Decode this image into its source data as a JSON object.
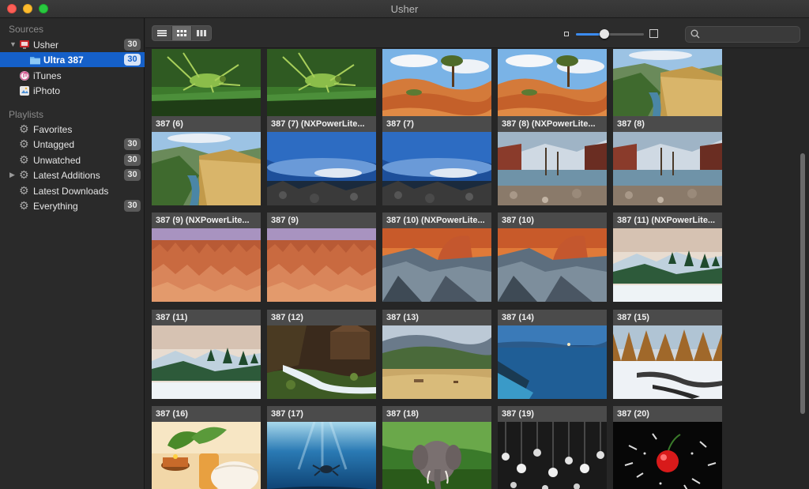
{
  "window": {
    "title": "Usher"
  },
  "sidebar": {
    "sources_header": "Sources",
    "sources": [
      {
        "label": "Usher",
        "count": "30",
        "icon": "usher-app-icon"
      },
      {
        "label": "Ultra 387",
        "count": "30",
        "icon": "folder-icon",
        "selected": true
      },
      {
        "label": "iTunes",
        "count": "",
        "icon": "itunes-icon"
      },
      {
        "label": "iPhoto",
        "count": "",
        "icon": "iphoto-icon"
      }
    ],
    "playlists_header": "Playlists",
    "playlists": [
      {
        "label": "Favorites",
        "count": ""
      },
      {
        "label": "Untagged",
        "count": "30"
      },
      {
        "label": "Unwatched",
        "count": "30"
      },
      {
        "label": "Latest Additions",
        "count": "30"
      },
      {
        "label": "Latest Downloads",
        "count": ""
      },
      {
        "label": "Everything",
        "count": "30"
      }
    ]
  },
  "toolbar": {
    "view_modes": [
      "list-view-icon",
      "grid-view-icon",
      "column-view-icon"
    ],
    "active_view": 1,
    "zoom_level": 0.42,
    "search_placeholder": ""
  },
  "grid": {
    "items": [
      {
        "title": "",
        "thumb": "grasshopper"
      },
      {
        "title": "",
        "thumb": "grasshopper"
      },
      {
        "title": "",
        "thumb": "desert-tree"
      },
      {
        "title": "",
        "thumb": "desert-tree"
      },
      {
        "title": "",
        "thumb": "canyon-river"
      },
      {
        "title": "387 (6)",
        "thumb": "canyon-river"
      },
      {
        "title": "387 (7) (NXPowerLite...",
        "thumb": "blue-sky-rocks"
      },
      {
        "title": "387 (7)",
        "thumb": "blue-sky-rocks"
      },
      {
        "title": "387 (8) (NXPowerLite...",
        "thumb": "lake-trees"
      },
      {
        "title": "387 (8)",
        "thumb": "lake-trees"
      },
      {
        "title": "387 (9) (NXPowerLite...",
        "thumb": "bryce-canyon"
      },
      {
        "title": "387 (9)",
        "thumb": "bryce-canyon"
      },
      {
        "title": "387 (10) (NXPowerLite...",
        "thumb": "half-dome"
      },
      {
        "title": "387 (10)",
        "thumb": "half-dome"
      },
      {
        "title": "387 (11) (NXPowerLite...",
        "thumb": "snowy-mountain"
      },
      {
        "title": "387 (11)",
        "thumb": "snowy-mountain"
      },
      {
        "title": "387 (12)",
        "thumb": "waterfall-forest"
      },
      {
        "title": "387 (13)",
        "thumb": "valley-hills"
      },
      {
        "title": "387 (14)",
        "thumb": "blue-lake-dusk"
      },
      {
        "title": "387 (15)",
        "thumb": "snowy-forest"
      },
      {
        "title": "387 (16)",
        "thumb": "spa-candle"
      },
      {
        "title": "387 (17)",
        "thumb": "underwater-turtle"
      },
      {
        "title": "387 (18)",
        "thumb": "elephant"
      },
      {
        "title": "387 (19)",
        "thumb": "light-bulbs"
      },
      {
        "title": "387 (20)",
        "thumb": "cherry-splash"
      }
    ]
  }
}
